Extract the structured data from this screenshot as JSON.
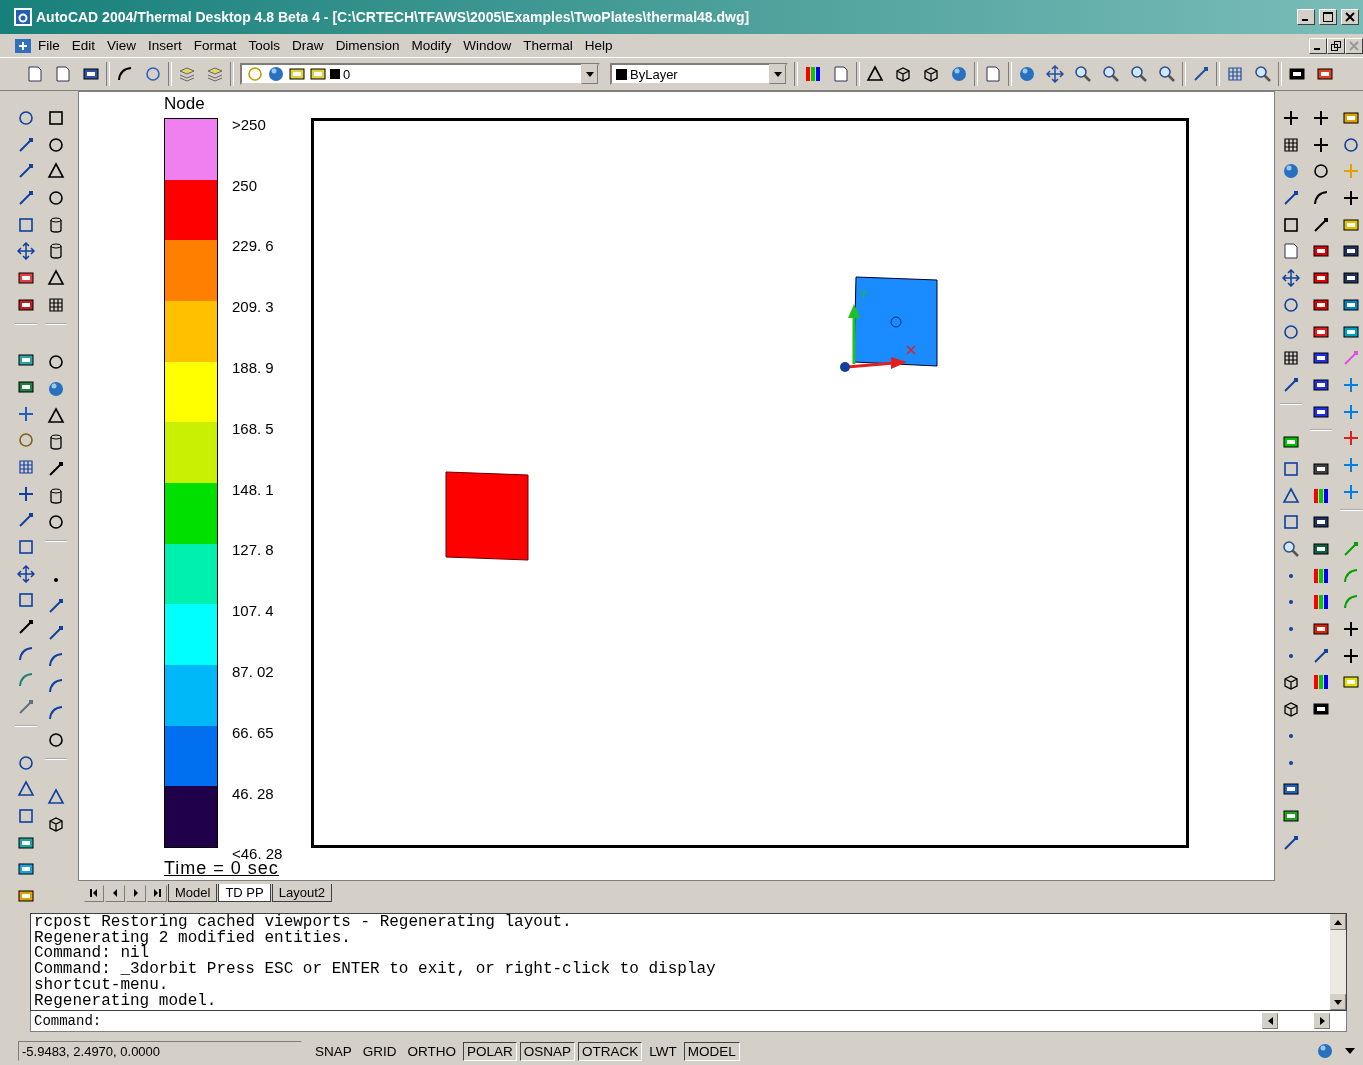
{
  "window": {
    "title": "AutoCAD 2004/Thermal Desktop 4.8 Beta 4 - [C:\\CRTECH\\TFAWS\\2005\\Examples\\TwoPlates\\thermal48.dwg]"
  },
  "menu": [
    "File",
    "Edit",
    "View",
    "Insert",
    "Format",
    "Tools",
    "Draw",
    "Dimension",
    "Modify",
    "Window",
    "Thermal",
    "Help"
  ],
  "layer_combo": {
    "value": "0"
  },
  "color_combo": {
    "value": "ByLayer"
  },
  "legend": {
    "title": "Node",
    "bands": [
      {
        "color": "#f080f0"
      },
      {
        "color": "#ff0000"
      },
      {
        "color": "#ff8000"
      },
      {
        "color": "#ffc000"
      },
      {
        "color": "#ffff00"
      },
      {
        "color": "#c8f000"
      },
      {
        "color": "#00e000"
      },
      {
        "color": "#00f0b0"
      },
      {
        "color": "#00ffff"
      },
      {
        "color": "#00b8f8"
      },
      {
        "color": "#0070f0"
      },
      {
        "color": "#200048"
      }
    ],
    "ticks": [
      ">250",
      "250",
      "229. 6",
      "209. 3",
      "188. 9",
      "168. 5",
      "148. 1",
      "127. 8",
      "107. 4",
      "87. 02",
      "66. 65",
      "46. 28",
      "<46. 28"
    ],
    "time": "Time = 0 sec"
  },
  "plates": [
    {
      "color": "#ff0000"
    },
    {
      "color": "#1a8cff"
    }
  ],
  "axis_label": "Y",
  "layout_tabs": [
    {
      "label": "Model",
      "selected": false
    },
    {
      "label": "TD PP",
      "selected": true
    },
    {
      "label": "Layout2",
      "selected": false
    }
  ],
  "command_history": [
    "rcpost Restoring cached viewports - Regenerating layout.",
    "Regenerating 2 modified entities.",
    "Command: nil",
    "Command: _3dorbit Press ESC or ENTER to exit, or right-click to display",
    "shortcut-menu.",
    "Regenerating model."
  ],
  "command_prompt": "Command:",
  "status_bar": {
    "coordinates": "-5.9483, 2.4970, 0.0000",
    "toggles": [
      {
        "label": "SNAP",
        "on": false
      },
      {
        "label": "GRID",
        "on": false
      },
      {
        "label": "ORTHO",
        "on": false
      },
      {
        "label": "POLAR",
        "on": true
      },
      {
        "label": "OSNAP",
        "on": true
      },
      {
        "label": "OTRACK",
        "on": true
      },
      {
        "label": "LWT",
        "on": false
      },
      {
        "label": "MODEL",
        "on": true
      }
    ]
  }
}
